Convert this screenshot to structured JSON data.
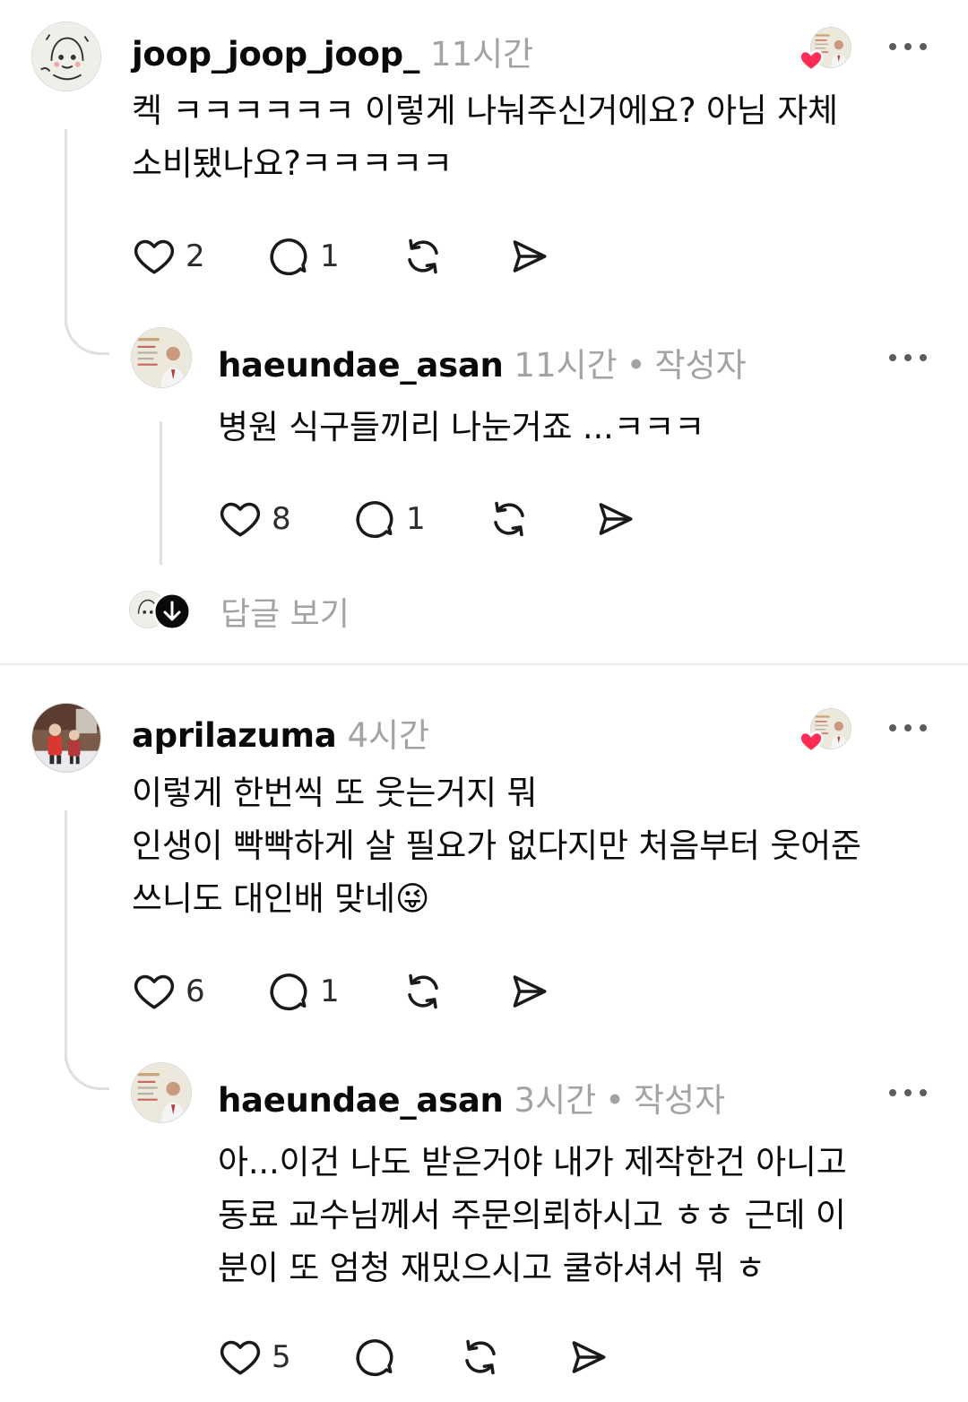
{
  "threads": [
    {
      "comment": {
        "username": "joop_joop_joop_",
        "time": "11시간",
        "lines": [
          "켁 ㅋㅋㅋㅋㅋㅋ 이렇게 나눠주신거에요? 아님 자체",
          "소비됐나요?ㅋㅋㅋㅋㅋ"
        ],
        "likes": "2",
        "replies": "1"
      },
      "reply": {
        "username": "haeundae_asan",
        "time": "11시간",
        "author_badge": "작성자",
        "lines": [
          "병원 식구들끼리 나눈거죠 ...ㅋㅋㅋ"
        ],
        "likes": "8",
        "replies": "1"
      },
      "view_replies_label": "답글 보기"
    },
    {
      "comment": {
        "username": "aprilazuma",
        "time": "4시간",
        "lines": [
          "이렇게 한번씩 또 웃는거지 뭐",
          "인생이 빡빡하게 살 필요가 없다지만 처음부터 웃어준",
          "쓰니도 대인배 맞네😜"
        ],
        "likes": "6",
        "replies": "1"
      },
      "reply": {
        "username": "haeundae_asan",
        "time": "3시간",
        "author_badge": "작성자",
        "lines": [
          "아...이건 나도 받은거야  내가 제작한건 아니고",
          "동료 교수님께서 주문의뢰하시고  ㅎㅎ 근데 이",
          "분이 또 엄청 재밌으시고 쿨하셔서 뭐 ㅎ"
        ],
        "likes": "5"
      }
    }
  ],
  "icons": {
    "like": "heart-icon",
    "comment": "comment-bubble-icon",
    "repost": "repost-icon",
    "share": "share-send-icon",
    "more": "more-dots-icon",
    "author_liked": "author-liked-heart-icon",
    "expand": "arrow-down-icon"
  },
  "colors": {
    "text": "#0a0a0a",
    "muted": "#a3a3a3",
    "like_red": "#ff2d55",
    "thread_line": "#e0e0e0"
  }
}
